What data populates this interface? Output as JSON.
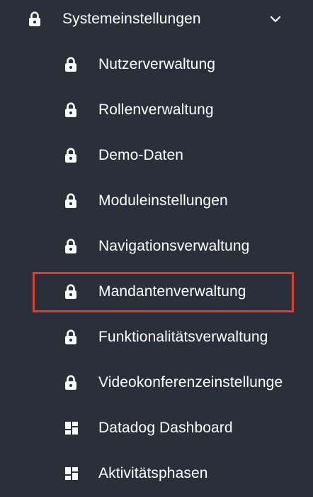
{
  "menu": {
    "parent": {
      "label": "Systemeinstellungen",
      "icon": "lock-icon",
      "expanded": true,
      "chevron_icon": "chevron-down-icon"
    },
    "children": [
      {
        "label": "Nutzerverwaltung",
        "icon": "lock-icon"
      },
      {
        "label": "Rollenverwaltung",
        "icon": "lock-icon"
      },
      {
        "label": "Demo-Daten",
        "icon": "lock-icon"
      },
      {
        "label": "Moduleinstellungen",
        "icon": "lock-icon"
      },
      {
        "label": "Navigationsverwaltung",
        "icon": "lock-icon"
      },
      {
        "label": "Mandantenverwaltung",
        "icon": "lock-icon",
        "highlighted": true
      },
      {
        "label": "Funktionalitätsverwaltung",
        "icon": "lock-icon"
      },
      {
        "label": "Videokonferenzeinstellunge",
        "icon": "lock-icon"
      },
      {
        "label": "Datadog Dashboard",
        "icon": "dashboard-icon"
      },
      {
        "label": "Aktivitätsphasen",
        "icon": "dashboard-icon"
      }
    ]
  },
  "colors": {
    "background": "#2b2f3a",
    "text": "#ffffff",
    "highlight_border": "#d9402e"
  }
}
